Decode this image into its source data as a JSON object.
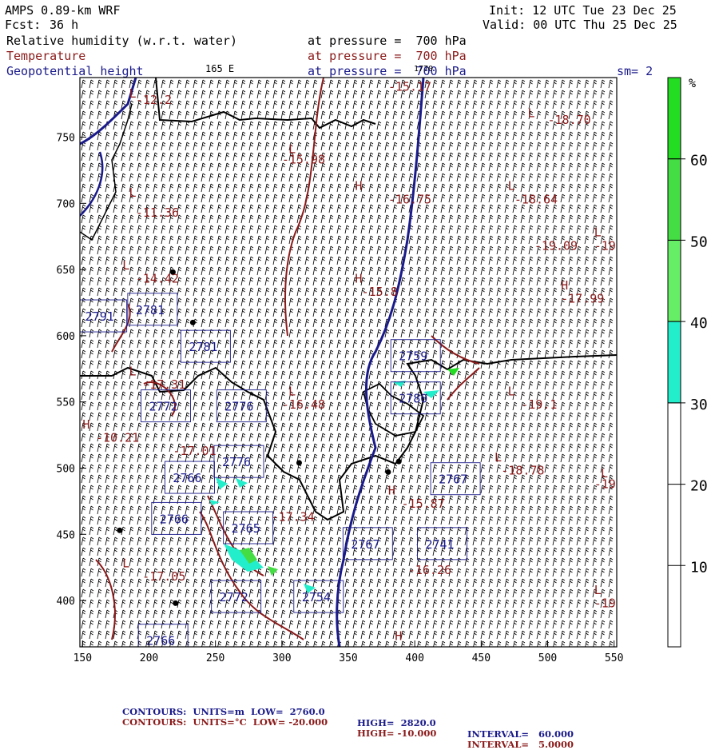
{
  "header": {
    "model": "AMPS 0.89-km WRF",
    "fcst_label": "Fcst:",
    "fcst_value": "36 h",
    "init": "Init: 12 UTC Tue 23 Dec 25",
    "valid": "Valid: 00 UTC Thu 25 Dec 25",
    "rh_label": "Relative humidity (w.r.t. water)",
    "temp_label": "Temperature",
    "geo_label": "Geopotential height",
    "pressure_rh": "at pressure =  700 hPa",
    "pressure_temp": "at pressure =  700 hPa",
    "pressure_geo": "at pressure =  700 hPa",
    "lon_label": "165 E",
    "lat_label": "1770",
    "sm": "sm= 2"
  },
  "map": {
    "x_ticks": [
      "150",
      "200",
      "250",
      "300",
      "350",
      "400",
      "450",
      "500",
      "550"
    ],
    "y_ticks": [
      "750",
      "700",
      "650",
      "600",
      "550",
      "500",
      "450",
      "400"
    ],
    "x_values": [
      150,
      200,
      250,
      300,
      350,
      400,
      450,
      500,
      550
    ],
    "y_values": [
      750,
      700,
      650,
      600,
      550,
      500,
      450,
      400
    ],
    "x_range": [
      148,
      552
    ],
    "y_range": [
      365,
      795
    ],
    "temperature_labels": [
      {
        "text": "-12.2",
        "x": 190,
        "y": 775
      },
      {
        "text": "-15.17",
        "x": 380,
        "y": 785
      },
      {
        "text": "-18.70",
        "x": 500,
        "y": 760
      },
      {
        "text": "-15.98",
        "x": 300,
        "y": 730
      },
      {
        "text": "-16.75",
        "x": 380,
        "y": 700
      },
      {
        "text": "-18.64",
        "x": 475,
        "y": 700
      },
      {
        "text": "-11.36",
        "x": 190,
        "y": 690
      },
      {
        "text": "-19.09",
        "x": 490,
        "y": 665
      },
      {
        "text": "-19",
        "x": 535,
        "y": 665
      },
      {
        "text": "-14.42",
        "x": 190,
        "y": 640
      },
      {
        "text": "-15.8",
        "x": 360,
        "y": 630
      },
      {
        "text": "-17.99",
        "x": 510,
        "y": 625
      },
      {
        "text": "-17.31",
        "x": 195,
        "y": 560
      },
      {
        "text": "-16.48",
        "x": 300,
        "y": 545
      },
      {
        "text": "-19.1",
        "x": 480,
        "y": 545
      },
      {
        "text": "-10.21",
        "x": 160,
        "y": 520
      },
      {
        "text": "-17.01",
        "x": 218,
        "y": 510
      },
      {
        "text": "-18.78",
        "x": 465,
        "y": 495
      },
      {
        "text": "-19",
        "x": 535,
        "y": 485
      },
      {
        "text": "-15.87",
        "x": 390,
        "y": 470
      },
      {
        "text": "-17.34",
        "x": 292,
        "y": 460
      },
      {
        "text": "-17.05",
        "x": 195,
        "y": 415
      },
      {
        "text": "-16.26",
        "x": 395,
        "y": 420
      },
      {
        "text": "-19",
        "x": 535,
        "y": 395
      }
    ],
    "height_labels": [
      {
        "text": "2781",
        "x": 190,
        "y": 620
      },
      {
        "text": "2791",
        "x": 152,
        "y": 615
      },
      {
        "text": "2781",
        "x": 230,
        "y": 592
      },
      {
        "text": "2759",
        "x": 388,
        "y": 585
      },
      {
        "text": "2780",
        "x": 388,
        "y": 553
      },
      {
        "text": "2772",
        "x": 200,
        "y": 547
      },
      {
        "text": "2776",
        "x": 257,
        "y": 547
      },
      {
        "text": "2766",
        "x": 218,
        "y": 493
      },
      {
        "text": "2776",
        "x": 255,
        "y": 505
      },
      {
        "text": "2766",
        "x": 208,
        "y": 462
      },
      {
        "text": "2767",
        "x": 418,
        "y": 492
      },
      {
        "text": "2765",
        "x": 262,
        "y": 455
      },
      {
        "text": "2767",
        "x": 352,
        "y": 443
      },
      {
        "text": "2741",
        "x": 408,
        "y": 443
      },
      {
        "text": "2772",
        "x": 253,
        "y": 403
      },
      {
        "text": "2754",
        "x": 315,
        "y": 403
      },
      {
        "text": "2766",
        "x": 198,
        "y": 370
      }
    ],
    "hl_markers": [
      {
        "text": "L",
        "x": 185,
        "y": 780
      },
      {
        "text": "L",
        "x": 305,
        "y": 738
      },
      {
        "text": "H",
        "x": 355,
        "y": 710
      },
      {
        "text": "L",
        "x": 485,
        "y": 765
      },
      {
        "text": "L",
        "x": 470,
        "y": 710
      },
      {
        "text": "L",
        "x": 535,
        "y": 675
      },
      {
        "text": "L",
        "x": 185,
        "y": 705
      },
      {
        "text": "L",
        "x": 180,
        "y": 650
      },
      {
        "text": "H",
        "x": 355,
        "y": 640
      },
      {
        "text": "H",
        "x": 510,
        "y": 635
      },
      {
        "text": "L",
        "x": 185,
        "y": 570
      },
      {
        "text": "H",
        "x": 150,
        "y": 530
      },
      {
        "text": "L",
        "x": 305,
        "y": 555
      },
      {
        "text": "L",
        "x": 470,
        "y": 555
      },
      {
        "text": "L",
        "x": 460,
        "y": 505
      },
      {
        "text": "L",
        "x": 540,
        "y": 493
      },
      {
        "text": "H",
        "x": 380,
        "y": 480
      },
      {
        "text": "L",
        "x": 180,
        "y": 425
      },
      {
        "text": "H",
        "x": 385,
        "y": 370
      },
      {
        "text": "L",
        "x": 535,
        "y": 405
      }
    ],
    "station_dots": [
      {
        "x": 218,
        "y": 648
      },
      {
        "x": 233,
        "y": 610
      },
      {
        "x": 313,
        "y": 504
      },
      {
        "x": 380,
        "y": 497
      },
      {
        "x": 388,
        "y": 505
      },
      {
        "x": 178,
        "y": 453
      },
      {
        "x": 220,
        "y": 398
      }
    ],
    "colors": {
      "coast": "#000000",
      "temp": "#8b1a1a",
      "height": "#1a1a8b",
      "wind": "#000000"
    }
  },
  "legend": {
    "unit": "%",
    "labels": [
      "60",
      "50",
      "40",
      "30",
      "20",
      "10"
    ],
    "bands": [
      {
        "from": 60,
        "to": 70,
        "color": "#22dd22"
      },
      {
        "from": 50,
        "to": 60,
        "color": "#44dd44"
      },
      {
        "from": 40,
        "to": 50,
        "color": "#66ee66"
      },
      {
        "from": 30,
        "to": 40,
        "color": "#22eecc"
      },
      {
        "from": 0,
        "to": 30,
        "color": "#ffffff"
      }
    ]
  },
  "footer": {
    "line1_a": "CONTOURS:  UNITS=m  LOW=  2760.0",
    "line1_b": "HIGH=  2820.0",
    "line1_c": "INTERVAL=   60.000",
    "line2_a": "CONTOURS:  UNITS=°C  LOW= -20.000",
    "line2_b": "HIGH= -10.000",
    "line2_c": "INTERVAL=   5.0000"
  }
}
